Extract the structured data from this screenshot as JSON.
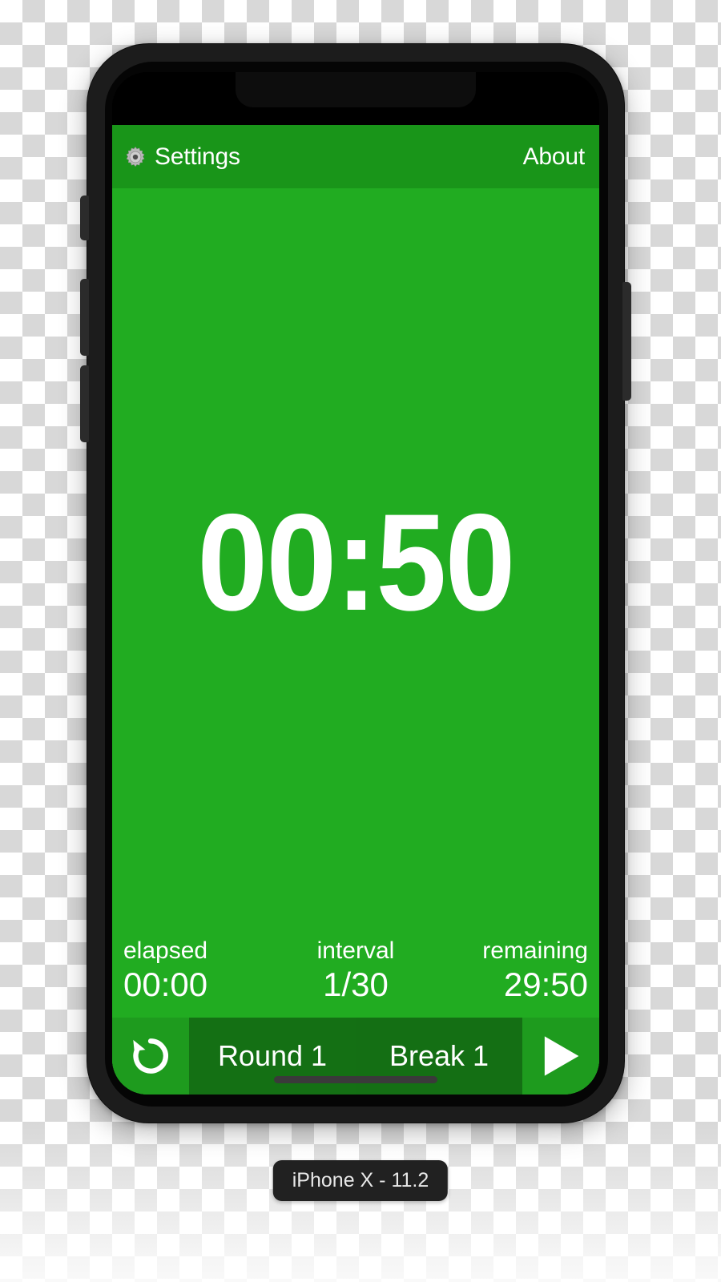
{
  "device": {
    "badge_label": "iPhone X - 11.2",
    "hardware_buttons": [
      {
        "name": "silent-switch"
      },
      {
        "name": "volume-up-button"
      },
      {
        "name": "volume-down-button"
      },
      {
        "name": "power-button"
      }
    ]
  },
  "app": {
    "navbar": {
      "settings_label": "Settings",
      "settings_icon": "gear-icon",
      "about_label": "About"
    },
    "timer": {
      "value": "00:50"
    },
    "stats": [
      {
        "label": "elapsed",
        "value": "00:00"
      },
      {
        "label": "interval",
        "value": "1/30"
      },
      {
        "label": "remaining",
        "value": "29:50"
      }
    ],
    "toolbar": {
      "reset_icon": "reset-icon",
      "round_label": "Round 1",
      "break_label": "Break 1",
      "play_icon": "play-icon"
    }
  },
  "colors": {
    "screen_background": "#21ac21",
    "navbar_background": "#199519",
    "toolbar_background": "#1e9b1e",
    "toolbar_segment": "#147014",
    "text": "#ffffff",
    "frame": "#1c1c1c",
    "badge_background": "#212121"
  }
}
